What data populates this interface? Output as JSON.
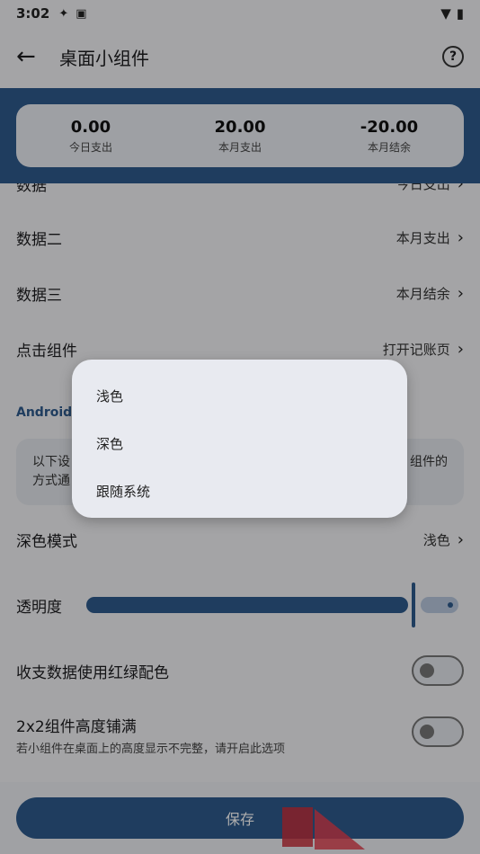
{
  "status_bar": {
    "time": "3:02"
  },
  "app_bar": {
    "title": "桌面小组件",
    "back_icon": "arrow-left-icon",
    "help_icon": "help-circle-icon"
  },
  "preview": {
    "stats": [
      {
        "value": "0.00",
        "label": "今日支出"
      },
      {
        "value": "20.00",
        "label": "本月支出"
      },
      {
        "value": "-20.00",
        "label": "本月结余"
      }
    ]
  },
  "settings": {
    "data1": {
      "label": "数据",
      "value": "今日支出"
    },
    "data2": {
      "label": "数据二",
      "value": "本月支出"
    },
    "data3": {
      "label": "数据三",
      "value": "本月结余"
    },
    "click": {
      "label": "点击组件",
      "value": "打开记账页"
    },
    "android_section_title": "Android 組",
    "info_text_left_1": "以下设",
    "info_text_right_1": "组件的",
    "info_text_left_2": "方式通",
    "dark_mode": {
      "label": "深色模式",
      "value": "浅色"
    },
    "opacity": {
      "label": "透明度",
      "value": 0.9
    },
    "red_green": {
      "label": "收支数据使用红绿配色",
      "enabled": false
    },
    "full_height": {
      "label": "2x2组件高度铺满",
      "hint": "若小组件在桌面上的高度显示不完整，请开启此选项",
      "enabled": false
    }
  },
  "save_label": "保存",
  "popup": {
    "options": [
      "浅色",
      "深色",
      "跟随系统"
    ]
  },
  "colors": {
    "primary": "#2f5a8c",
    "scrim": "rgba(0,0,0,0.32)"
  }
}
